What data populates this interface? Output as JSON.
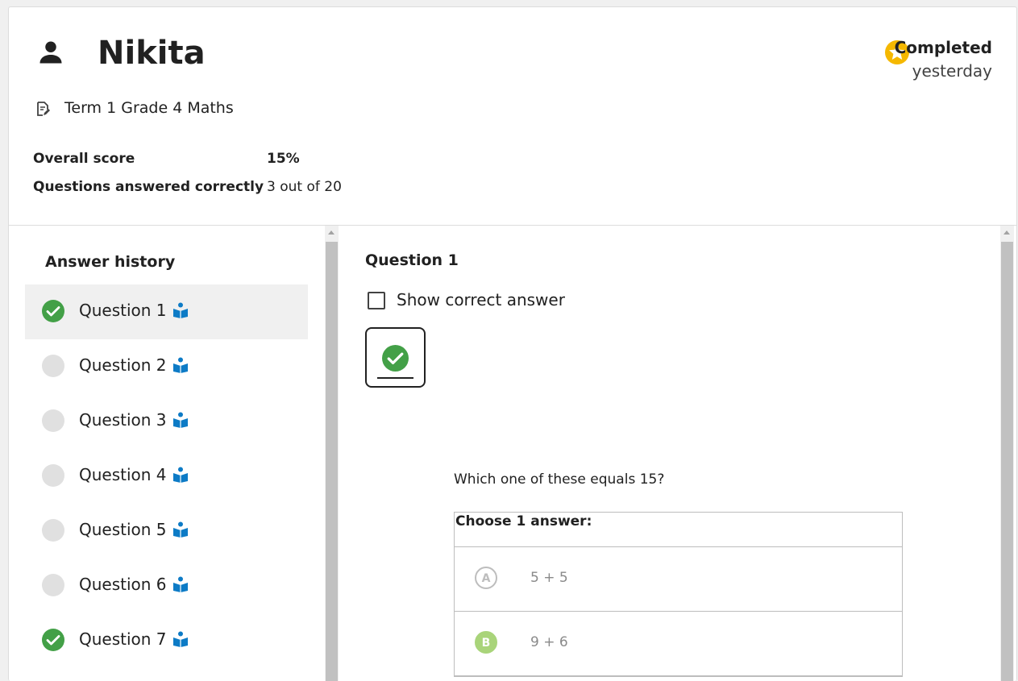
{
  "learner": {
    "name": "Nikita",
    "icon": "person-icon"
  },
  "status": {
    "label": "Completed",
    "time": "yesterday",
    "icon": "star-icon",
    "color": "#f5b800"
  },
  "quiz": {
    "title": "Term 1 Grade 4 Maths",
    "icon": "quiz-icon"
  },
  "summary": {
    "score_label": "Overall score",
    "score_value": "15%",
    "correct_label": "Questions answered correctly",
    "correct_value": "3 out of 20"
  },
  "history": {
    "title": "Answer history",
    "items": [
      {
        "label": "Question 1",
        "status": "correct",
        "selected": true
      },
      {
        "label": "Question 2",
        "status": "unanswered",
        "selected": false
      },
      {
        "label": "Question 3",
        "status": "unanswered",
        "selected": false
      },
      {
        "label": "Question 4",
        "status": "unanswered",
        "selected": false
      },
      {
        "label": "Question 5",
        "status": "unanswered",
        "selected": false
      },
      {
        "label": "Question 6",
        "status": "unanswered",
        "selected": false
      },
      {
        "label": "Question 7",
        "status": "correct",
        "selected": false
      }
    ]
  },
  "question": {
    "title": "Question 1",
    "show_correct_label": "Show correct answer",
    "show_correct_checked": false,
    "attempt_result": "correct",
    "text": "Which one of these equals 15?",
    "choose_label": "Choose 1 answer:",
    "choices": [
      {
        "letter": "A",
        "text": "5 + 5",
        "picked": false
      },
      {
        "letter": "B",
        "text": "9 + 6",
        "picked": true
      }
    ]
  },
  "colors": {
    "correct": "#43a047",
    "exercise_icon": "#0d7bc6",
    "picked": "#a9d47a"
  }
}
